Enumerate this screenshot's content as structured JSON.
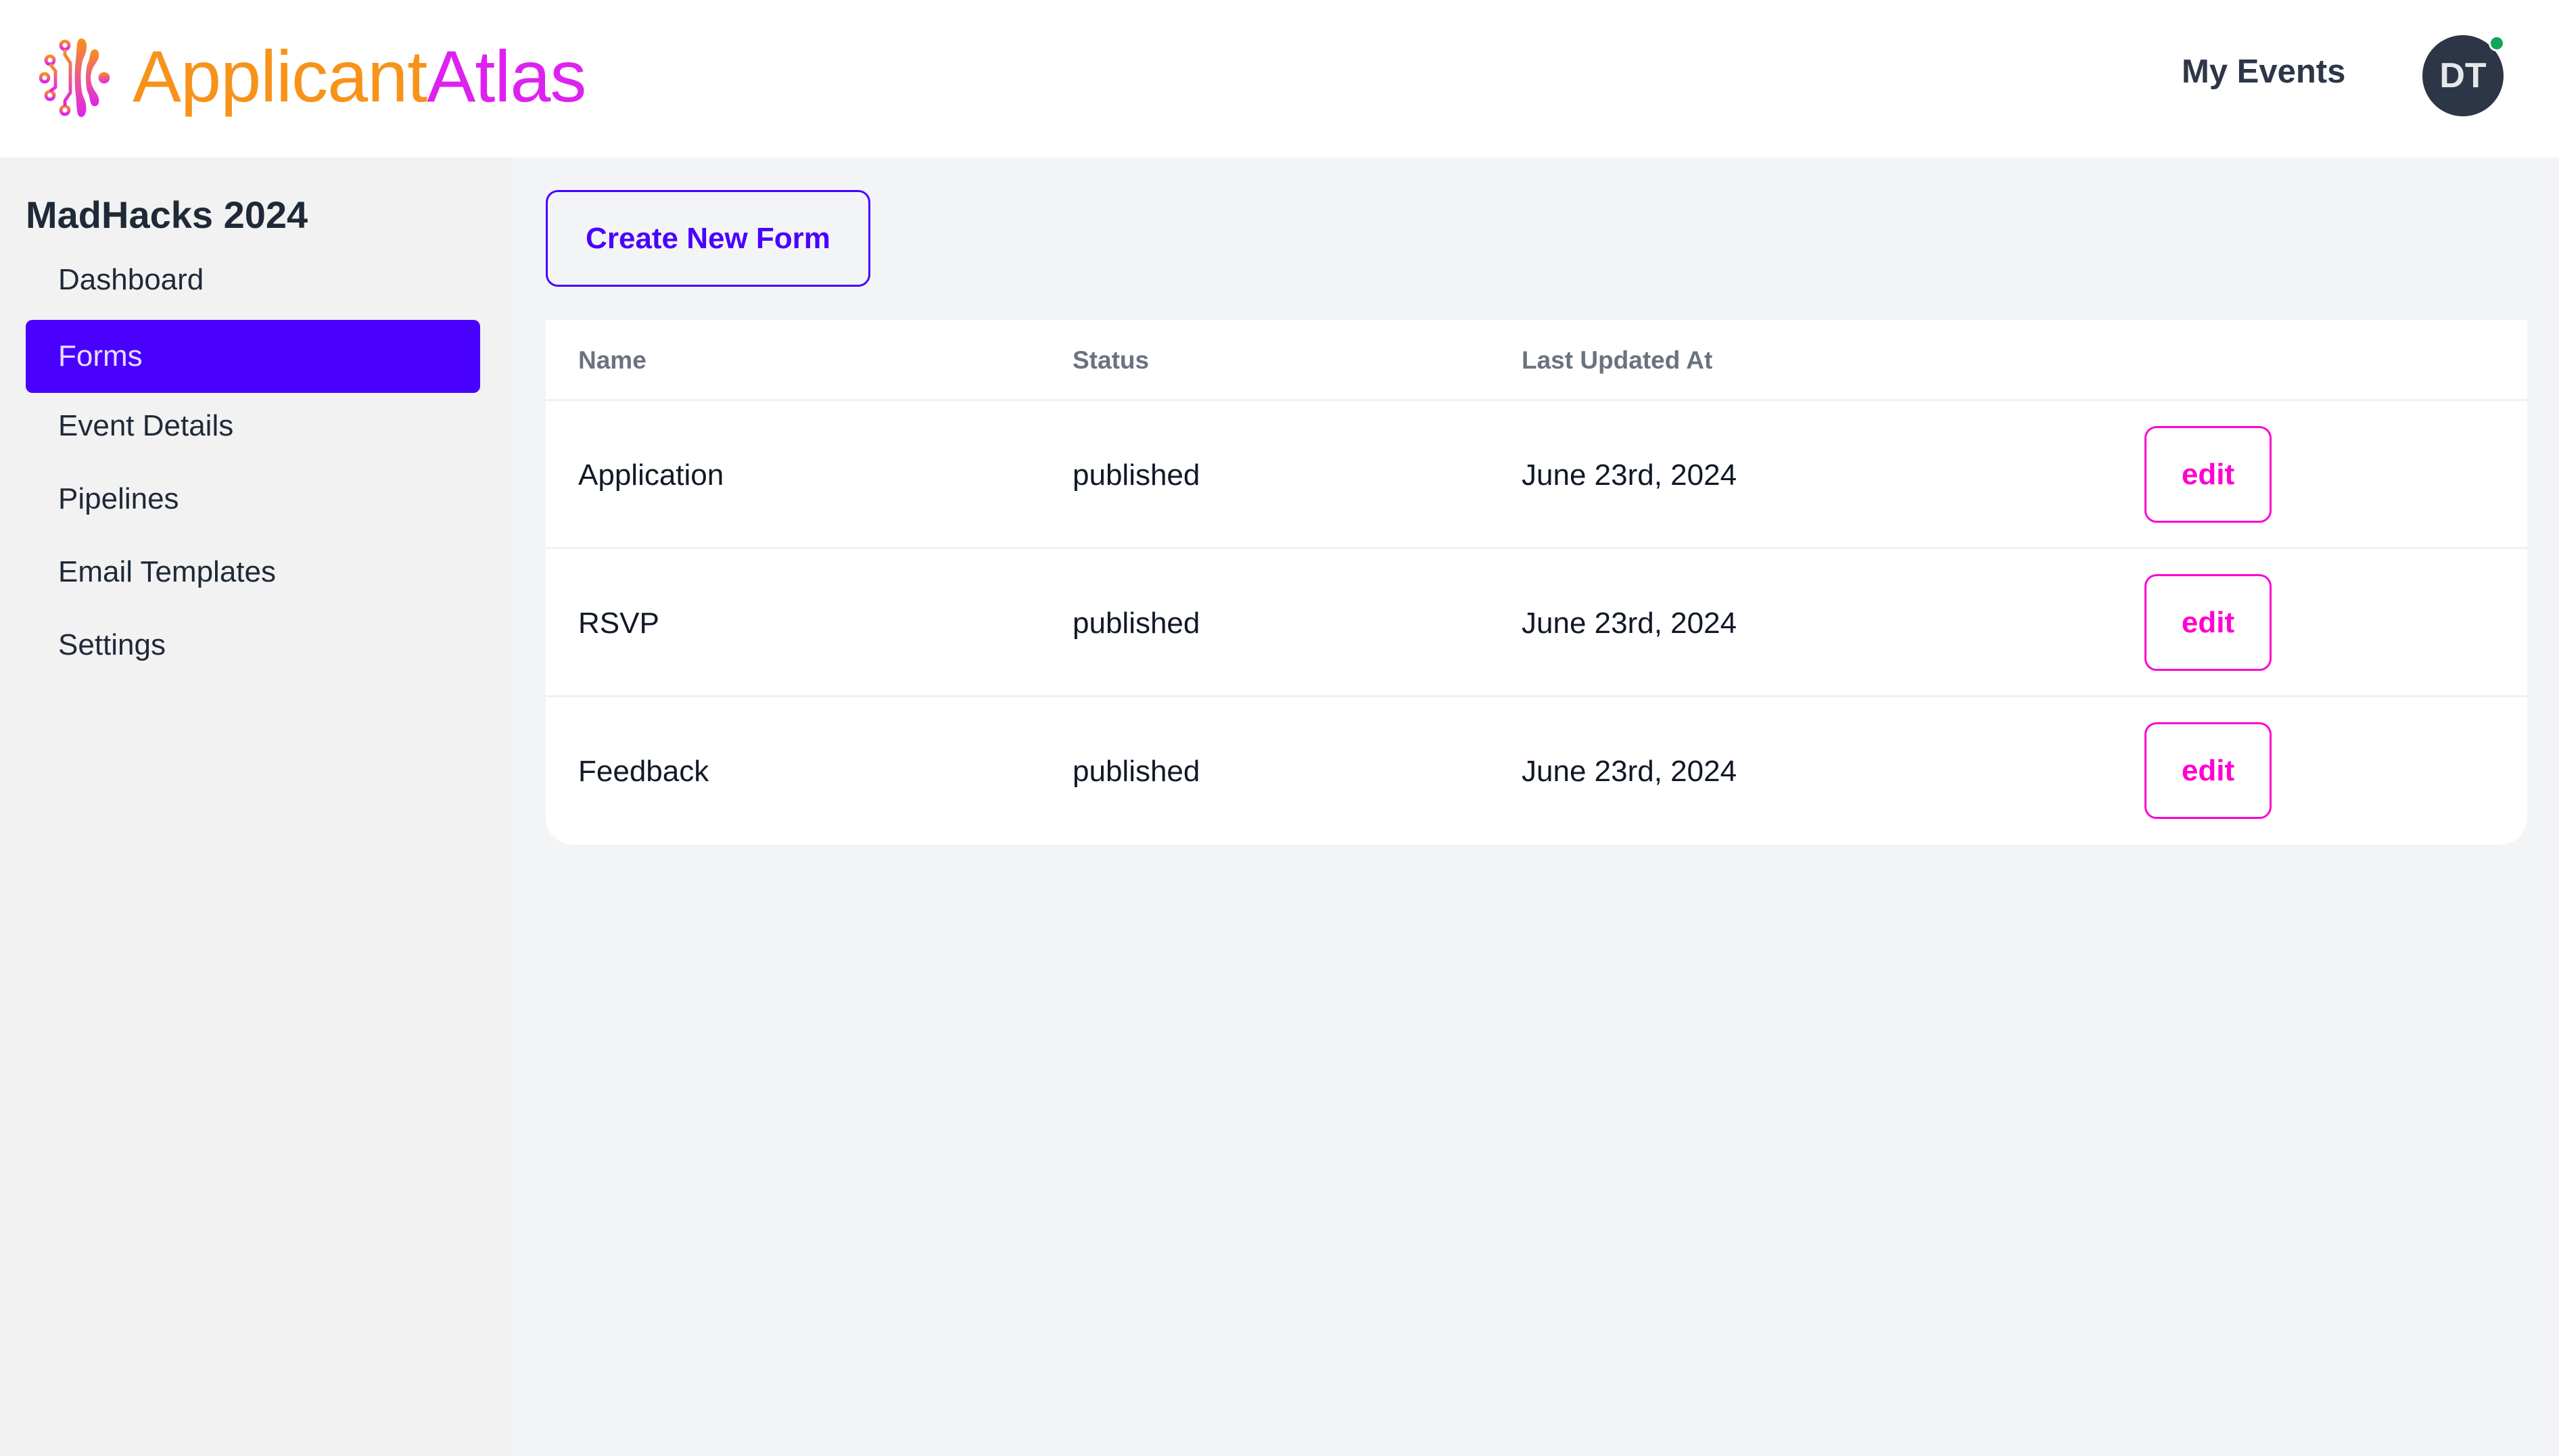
{
  "header": {
    "logo": {
      "part1": "Applicant",
      "part2": "Atlas",
      "icon": "circuit-brain-icon"
    },
    "nav_link": "My Events",
    "avatar_initials": "DT",
    "presence_status": "online"
  },
  "sidebar": {
    "event_name": "MadHacks 2024",
    "items": [
      {
        "label": "Dashboard",
        "active": false
      },
      {
        "label": "Forms",
        "active": true
      },
      {
        "label": "Event Details",
        "active": false
      },
      {
        "label": "Pipelines",
        "active": false
      },
      {
        "label": "Email Templates",
        "active": false
      },
      {
        "label": "Settings",
        "active": false
      }
    ]
  },
  "main": {
    "create_button": "Create New Form",
    "table": {
      "columns": [
        "Name",
        "Status",
        "Last Updated At"
      ],
      "rows": [
        {
          "name": "Application",
          "status": "published",
          "updated": "June 23rd, 2024",
          "action": "edit"
        },
        {
          "name": "RSVP",
          "status": "published",
          "updated": "June 23rd, 2024",
          "action": "edit"
        },
        {
          "name": "Feedback",
          "status": "published",
          "updated": "June 23rd, 2024",
          "action": "edit"
        }
      ]
    }
  },
  "colors": {
    "brand_orange": "#f7931a",
    "brand_magenta": "#dd22f0",
    "primary": "#4a00ff",
    "edit_accent": "#ff00d0",
    "presence_green": "#10a65a"
  }
}
